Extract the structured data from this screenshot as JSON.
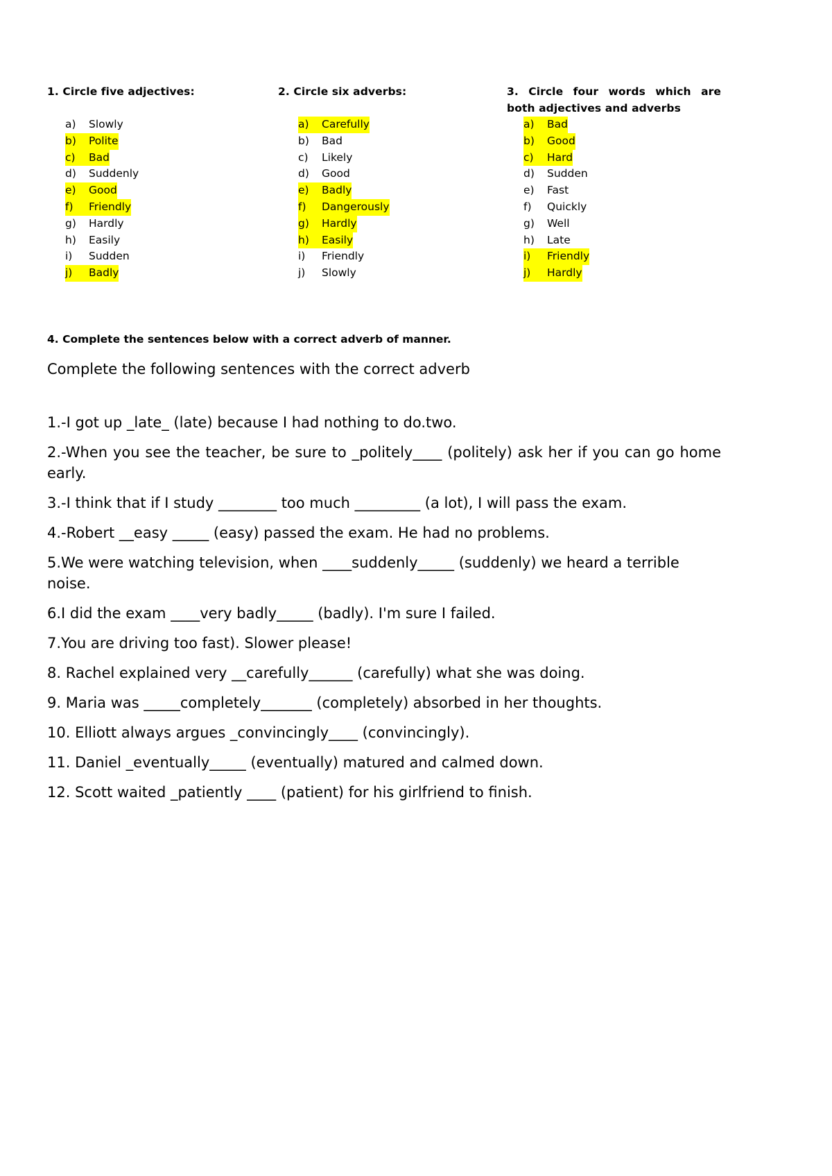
{
  "document": {
    "exercises": [
      {
        "number": "1",
        "heading": "1. Circle five adjectives:",
        "items": [
          {
            "marker": "a)",
            "word": "Slowly",
            "highlighted": false
          },
          {
            "marker": "b)",
            "word": "Polite",
            "highlighted": true
          },
          {
            "marker": "c)",
            "word": "Bad",
            "highlighted": true
          },
          {
            "marker": "d)",
            "word": "Suddenly",
            "highlighted": false
          },
          {
            "marker": "e)",
            "word": "Good",
            "highlighted": true
          },
          {
            "marker": "f)",
            "word": "Friendly",
            "highlighted": true
          },
          {
            "marker": "g)",
            "word": "Hardly",
            "highlighted": false
          },
          {
            "marker": "h)",
            "word": "Easily",
            "highlighted": false
          },
          {
            "marker": "i)",
            "word": "Sudden",
            "highlighted": false
          },
          {
            "marker": "j)",
            "word": "Badly",
            "highlighted": true
          }
        ]
      },
      {
        "number": "2",
        "heading": "2. Circle six adverbs:",
        "items": [
          {
            "marker": "a)",
            "word": "Carefully",
            "highlighted": true
          },
          {
            "marker": "b)",
            "word": "Bad",
            "highlighted": false
          },
          {
            "marker": "c)",
            "word": "Likely",
            "highlighted": false
          },
          {
            "marker": "d)",
            "word": "Good",
            "highlighted": false
          },
          {
            "marker": "e)",
            "word": "Badly",
            "highlighted": true
          },
          {
            "marker": "f)",
            "word": "Dangerously",
            "highlighted": true
          },
          {
            "marker": "g)",
            "word": "Hardly",
            "highlighted": true
          },
          {
            "marker": "h)",
            "word": "Easily",
            "highlighted": true
          },
          {
            "marker": "i)",
            "word": "Friendly",
            "highlighted": false
          },
          {
            "marker": "j)",
            "word": "Slowly",
            "highlighted": false
          }
        ]
      },
      {
        "number": "3",
        "heading_line1": "3. Circle four words which are",
        "heading_line2": "both adjectives and adverbs",
        "items": [
          {
            "marker": "a)",
            "word": "Bad",
            "highlighted": true
          },
          {
            "marker": "b)",
            "word": "Good",
            "highlighted": true
          },
          {
            "marker": "c)",
            "word": "Hard",
            "highlighted": true
          },
          {
            "marker": "d)",
            "word": "Sudden",
            "highlighted": false
          },
          {
            "marker": "e)",
            "word": "Fast",
            "highlighted": false
          },
          {
            "marker": "f)",
            "word": "Quickly",
            "highlighted": false
          },
          {
            "marker": "g)",
            "word": "Well",
            "highlighted": false
          },
          {
            "marker": "h)",
            "word": "Late",
            "highlighted": false
          },
          {
            "marker": "i)",
            "word": "Friendly",
            "highlighted": true
          },
          {
            "marker": "j)",
            "word": "Hardly",
            "highlighted": true
          }
        ]
      }
    ],
    "exercise4": {
      "heading": "4. Complete the sentences below with a correct adverb of manner.",
      "subheading": "Complete the following sentences with the correct adverb",
      "sentences": [
        "1.-I got up _late_ (late) because I had nothing to do.two.",
        "2.-When you see the teacher, be sure to _politely____ (politely) ask her if you can go home early.",
        "3.-I think that if I study ________ too much _________ (a lot), I will pass the exam.",
        "4.-Robert __easy _____ (easy) passed the exam. He had no problems.",
        "5.We were watching television, when ____suddenly_____ (suddenly) we heard a terrible noise.",
        "6.I did the exam ____very badly_____ (badly). I'm sure I failed.",
        "7.You are driving too fast). Slower please!",
        "8. Rachel explained very __carefully______ (carefully) what she was doing.",
        "9. Maria was _____completely_______ (completely) absorbed in her thoughts.",
        "10. Elliott always argues _convincingly____ (convincingly).",
        "11. Daniel _eventually_____ (eventually) matured and calmed down.",
        "12. Scott waited _patiently ____ (patient) for his girlfriend to finish."
      ]
    },
    "colors": {
      "highlight": "#ffff00",
      "text": "#000000",
      "background": "#ffffff"
    }
  }
}
